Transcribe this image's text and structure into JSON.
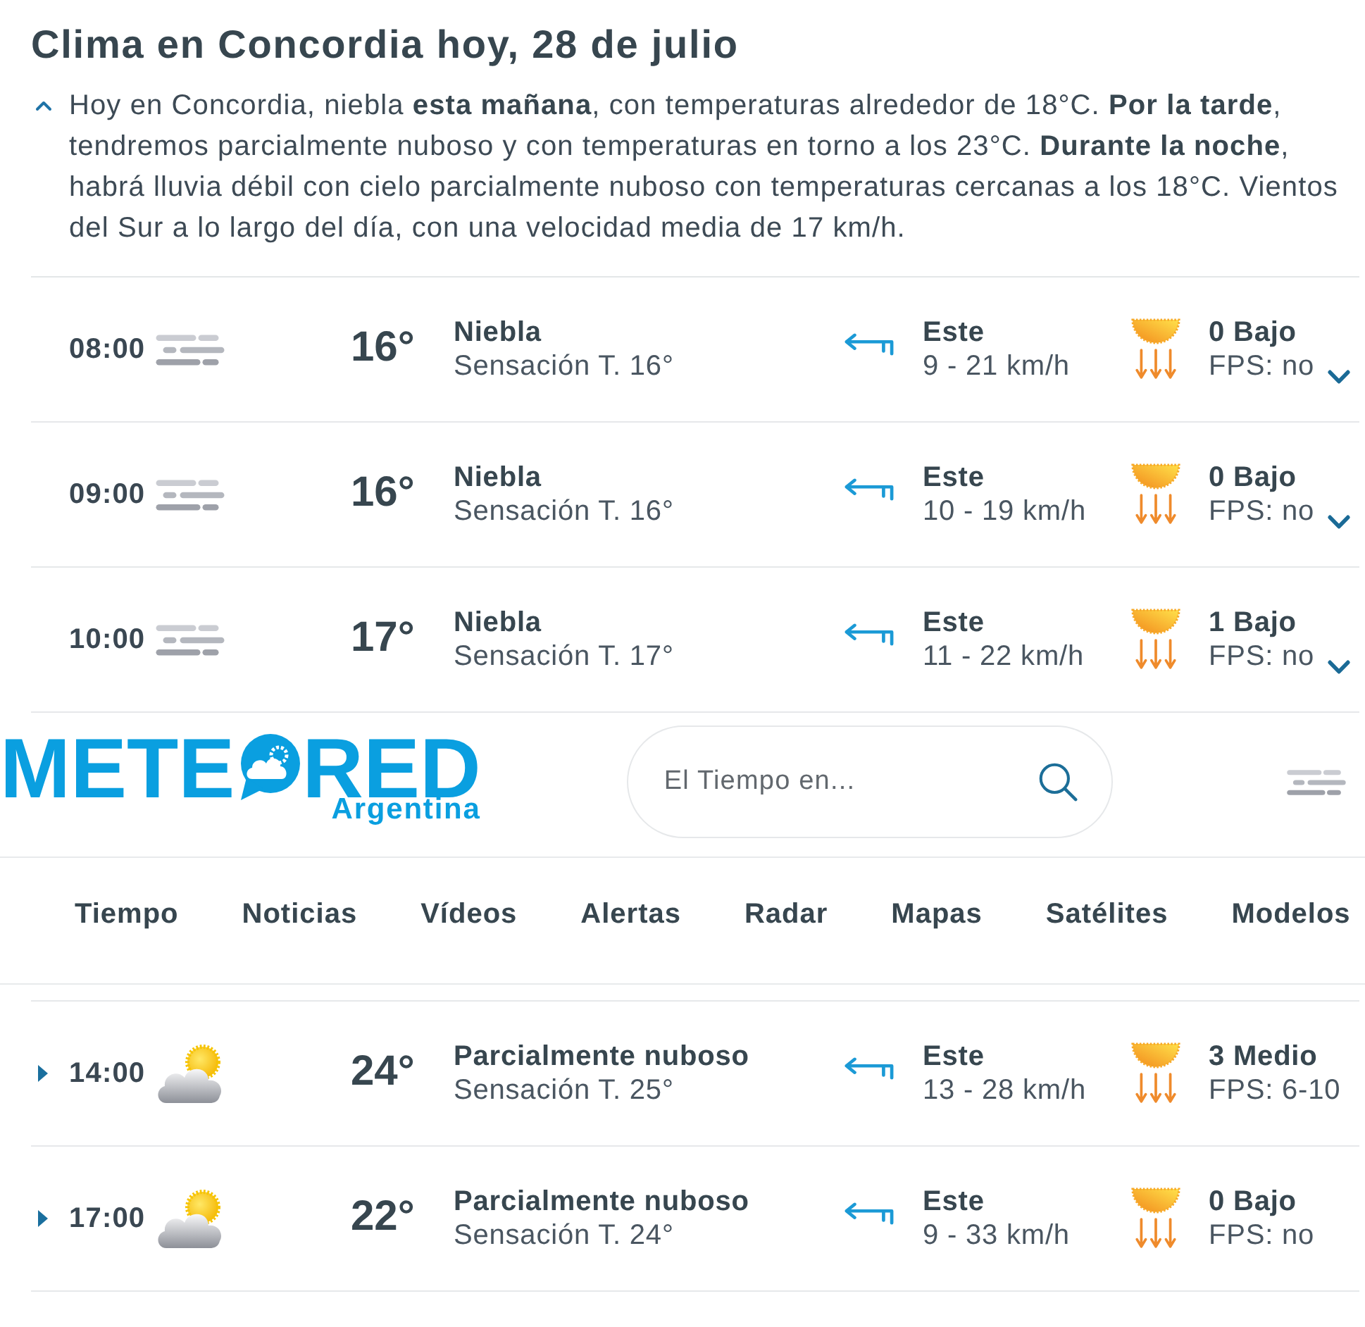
{
  "page_title": "Clima en Concordia hoy, 28 de julio",
  "summary": {
    "expanded": true,
    "text": "Hoy en Concordia, niebla **esta mañana**, con temperaturas alrededor de 18°C. **Por la tarde**, tendremos parcialmente nuboso y con temperaturas en torno a los 23°C. **Durante la noche**, habrá lluvia débil con cielo parcialmente nuboso con temperaturas cercanas a los 18°C. Vientos del Sur a lo largo del día, con una velocidad media de 17 km/h."
  },
  "hours_top": {
    "kind": "expandable",
    "rows": [
      {
        "kind": "fog",
        "time": "08:00",
        "temperature": "16°",
        "condition": "Niebla",
        "feels_like": "Sensación T. 16°",
        "wind_direction": "Este",
        "wind_speed": "9 - 21 km/h",
        "uv_index": "0 Bajo",
        "sun_protection": "FPS: no"
      },
      {
        "kind": "fog",
        "time": "09:00",
        "temperature": "16°",
        "condition": "Niebla",
        "feels_like": "Sensación T. 16°",
        "wind_direction": "Este",
        "wind_speed": "10 - 19 km/h",
        "uv_index": "0 Bajo",
        "sun_protection": "FPS: no"
      },
      {
        "kind": "fog",
        "time": "10:00",
        "temperature": "17°",
        "condition": "Niebla",
        "feels_like": "Sensación T. 17°",
        "wind_direction": "Este",
        "wind_speed": "11 - 22 km/h",
        "uv_index": "1 Bajo",
        "sun_protection": "FPS: no"
      }
    ]
  },
  "header": {
    "logo": {
      "wordmark_start": "METE",
      "wordmark_end": "RED",
      "region": "Argentina"
    },
    "search": {
      "placeholder": "El Tiempo en..."
    },
    "current": {
      "kind": "fog"
    },
    "nav": [
      {
        "label": "Tiempo",
        "selected": false
      },
      {
        "label": "Noticias",
        "selected": false
      },
      {
        "label": "Vídeos",
        "selected": false
      },
      {
        "label": "Alertas",
        "selected": false
      },
      {
        "label": "Radar",
        "selected": false
      },
      {
        "label": "Mapas",
        "selected": false
      },
      {
        "label": "Satélites",
        "selected": false
      },
      {
        "label": "Modelos",
        "selected": false
      }
    ]
  },
  "hours_bottom": {
    "kind": "marked",
    "rows": [
      {
        "kind": "partly_cloudy",
        "time": "14:00",
        "temperature": "24°",
        "condition": "Parcialmente nuboso",
        "feels_like": "Sensación T. 25°",
        "wind_direction": "Este",
        "wind_speed": "13 - 28 km/h",
        "uv_index": "3 Medio",
        "sun_protection": "FPS: 6-10"
      },
      {
        "kind": "partly_cloudy",
        "time": "17:00",
        "temperature": "22°",
        "condition": "Parcialmente nuboso",
        "feels_like": "Sensación T. 24°",
        "wind_direction": "Este",
        "wind_speed": "9 - 33 km/h",
        "uv_index": "0 Bajo",
        "sun_protection": "FPS: no"
      }
    ]
  }
}
